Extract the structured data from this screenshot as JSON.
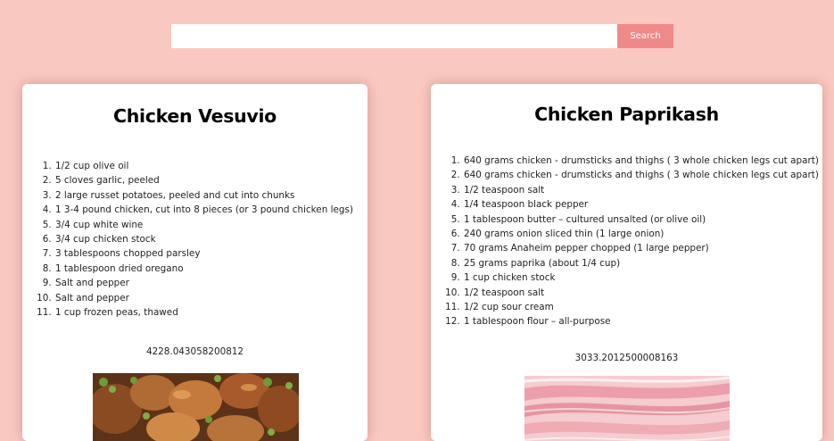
{
  "search": {
    "placeholder": "",
    "button_label": "Search"
  },
  "recipes": [
    {
      "title": "Chicken Vesuvio",
      "ingredients": [
        "1/2 cup olive oil",
        "5 cloves garlic, peeled",
        "2 large russet potatoes, peeled and cut into chunks",
        "1 3-4 pound chicken, cut into 8 pieces (or 3 pound chicken legs)",
        "3/4 cup white wine",
        "3/4 cup chicken stock",
        "3 tablespoons chopped parsley",
        "1 tablespoon dried oregano",
        "Salt and pepper",
        "Salt and pepper",
        "1 cup frozen peas, thawed"
      ],
      "score": "4228.043058200812",
      "image_icon": "chicken-dish-photo"
    },
    {
      "title": "Chicken Paprikash",
      "ingredients": [
        "640 grams chicken - drumsticks and thighs ( 3 whole chicken legs cut apart)",
        "640 grams chicken - drumsticks and thighs ( 3 whole chicken legs cut apart)",
        "1/2 teaspoon salt",
        "1/4 teaspoon black pepper",
        "1 tablespoon butter – cultured unsalted (or olive oil)",
        "240 grams onion sliced thin (1 large onion)",
        "70 grams Anaheim pepper chopped (1 large pepper)",
        "25 grams paprika (about 1/4 cup)",
        "1 cup chicken stock",
        "1/2 teaspoon salt",
        "1/2 cup sour cream",
        "1 tablespoon flour – all-purpose"
      ],
      "score": "3033.2012500008163",
      "image_icon": "paprikash-dish-photo"
    }
  ],
  "colors": {
    "background": "#f9c9c1",
    "search_button": "#f08a8a",
    "card": "#ffffff"
  }
}
